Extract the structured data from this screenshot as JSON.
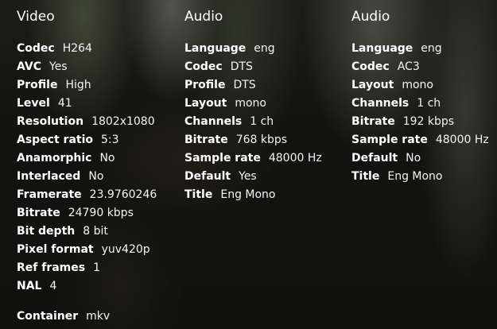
{
  "video": {
    "header": "Video",
    "rows": [
      {
        "label": "Codec",
        "value": "H264"
      },
      {
        "label": "AVC",
        "value": "Yes"
      },
      {
        "label": "Profile",
        "value": "High"
      },
      {
        "label": "Level",
        "value": "41"
      },
      {
        "label": "Resolution",
        "value": "1802x1080"
      },
      {
        "label": "Aspect ratio",
        "value": "5:3"
      },
      {
        "label": "Anamorphic",
        "value": "No"
      },
      {
        "label": "Interlaced",
        "value": "No"
      },
      {
        "label": "Framerate",
        "value": "23.9760246"
      },
      {
        "label": "Bitrate",
        "value": "24790 kbps"
      },
      {
        "label": "Bit depth",
        "value": "8 bit"
      },
      {
        "label": "Pixel format",
        "value": "yuv420p"
      },
      {
        "label": "Ref frames",
        "value": "1"
      },
      {
        "label": "NAL",
        "value": "4"
      }
    ]
  },
  "audio1": {
    "header": "Audio",
    "rows": [
      {
        "label": "Language",
        "value": "eng"
      },
      {
        "label": "Codec",
        "value": "DTS"
      },
      {
        "label": "Profile",
        "value": "DTS"
      },
      {
        "label": "Layout",
        "value": "mono"
      },
      {
        "label": "Channels",
        "value": "1 ch"
      },
      {
        "label": "Bitrate",
        "value": "768 kbps"
      },
      {
        "label": "Sample rate",
        "value": "48000 Hz"
      },
      {
        "label": "Default",
        "value": "Yes"
      },
      {
        "label": "Title",
        "value": "Eng Mono"
      }
    ]
  },
  "audio2": {
    "header": "Audio",
    "rows": [
      {
        "label": "Language",
        "value": "eng"
      },
      {
        "label": "Codec",
        "value": "AC3"
      },
      {
        "label": "Layout",
        "value": "mono"
      },
      {
        "label": "Channels",
        "value": "1 ch"
      },
      {
        "label": "Bitrate",
        "value": "192 kbps"
      },
      {
        "label": "Sample rate",
        "value": "48000 Hz"
      },
      {
        "label": "Default",
        "value": "No"
      },
      {
        "label": "Title",
        "value": "Eng Mono"
      }
    ]
  },
  "container": {
    "label": "Container",
    "value": "mkv"
  }
}
